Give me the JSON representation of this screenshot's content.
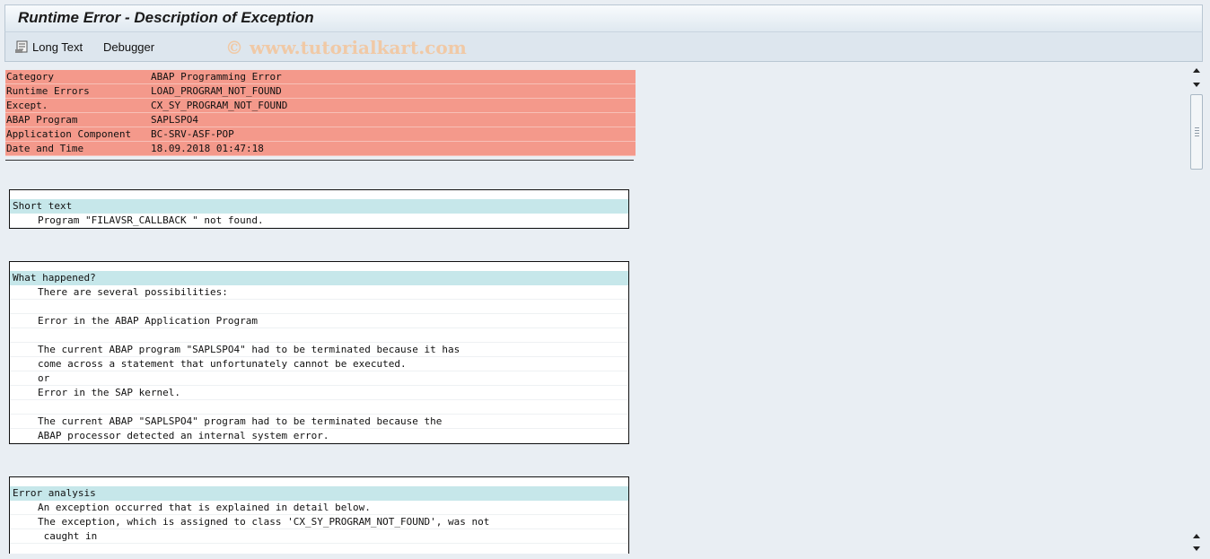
{
  "window": {
    "title": "Runtime Error - Description of Exception"
  },
  "toolbar": {
    "long_text_label": "Long Text",
    "debugger_label": "Debugger",
    "watermark": "© www.tutorialkart.com"
  },
  "header_info": [
    {
      "key": "Category",
      "value": "ABAP Programming Error"
    },
    {
      "key": "Runtime Errors",
      "value": "LOAD_PROGRAM_NOT_FOUND"
    },
    {
      "key": "Except.",
      "value": "CX_SY_PROGRAM_NOT_FOUND"
    },
    {
      "key": "ABAP Program",
      "value": "SAPLSPO4"
    },
    {
      "key": "Application Component",
      "value": "BC-SRV-ASF-POP"
    },
    {
      "key": "Date and Time",
      "value": "18.09.2018 01:47:18"
    }
  ],
  "short_text": {
    "heading": "Short text",
    "lines": [
      "Program \"FILAVSR_CALLBACK \" not found."
    ]
  },
  "what_happened": {
    "heading": "What happened?",
    "lines": [
      "There are several possibilities:",
      "",
      "Error in the ABAP Application Program",
      "",
      "The current ABAP program \"SAPLSPO4\" had to be terminated because it has",
      "come across a statement that unfortunately cannot be executed.",
      "or",
      "Error in the SAP kernel.",
      "",
      "The current ABAP \"SAPLSPO4\" program had to be terminated because the",
      "ABAP processor detected an internal system error."
    ]
  },
  "error_analysis": {
    "heading": "Error analysis",
    "lines": [
      "An exception occurred that is explained in detail below.",
      "The exception, which is assigned to class 'CX_SY_PROGRAM_NOT_FOUND', was not",
      " caught in"
    ]
  }
}
